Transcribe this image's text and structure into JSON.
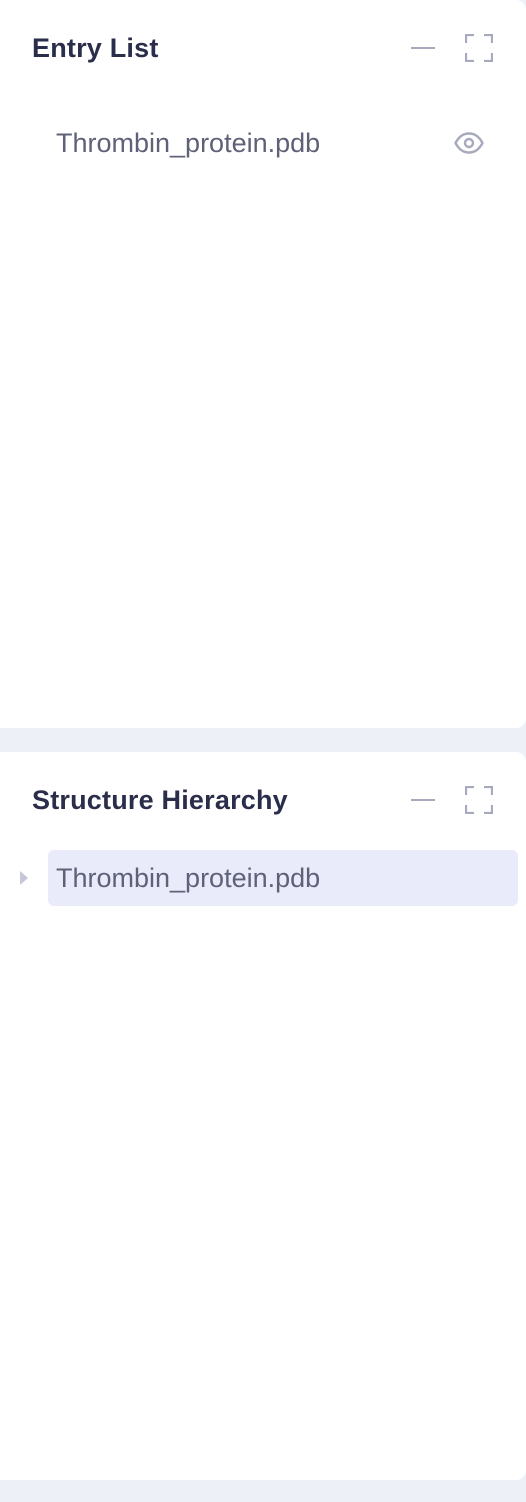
{
  "entry_list": {
    "title": "Entry List",
    "entries": [
      {
        "name": "Thrombin_protein.pdb",
        "visibility_icon": "eye-icon"
      }
    ]
  },
  "structure_hierarchy": {
    "title": "Structure Hierarchy",
    "items": [
      {
        "name": "Thrombin_protein.pdb",
        "expand_icon": "caret-right-icon",
        "selected": true
      }
    ]
  },
  "icons": {
    "minimize": "minus-icon",
    "maximize": "fullscreen-icon"
  },
  "colors": {
    "background": "#eef0f7",
    "panel": "#ffffff",
    "title_text": "#2b2e4a",
    "item_text": "#5e6178",
    "icon": "#a7a9bd",
    "selected_bg": "#e9ebfb"
  }
}
